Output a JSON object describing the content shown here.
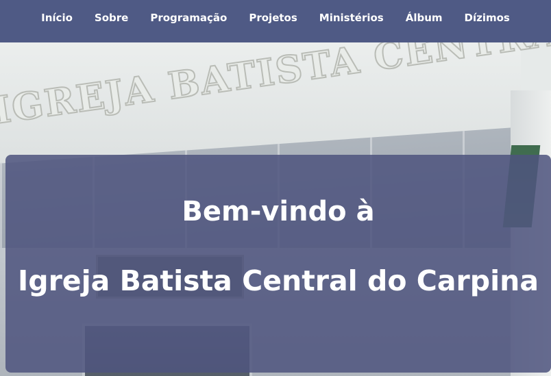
{
  "nav": {
    "items": [
      {
        "label": "Início"
      },
      {
        "label": "Sobre"
      },
      {
        "label": "Programação"
      },
      {
        "label": "Projetos"
      },
      {
        "label": "Ministérios"
      },
      {
        "label": "Álbum"
      },
      {
        "label": "Dízimos"
      }
    ]
  },
  "hero": {
    "background_image": "church-building-photo",
    "facade_text": "IGREJA BATISTA CENTRAL",
    "welcome_line1": "Bem-vindo à",
    "welcome_line2": "Igreja Batista Central do Carpina"
  },
  "colors": {
    "navbar": "#4f5a85",
    "overlay": "#4e547e",
    "text": "#ffffff"
  }
}
